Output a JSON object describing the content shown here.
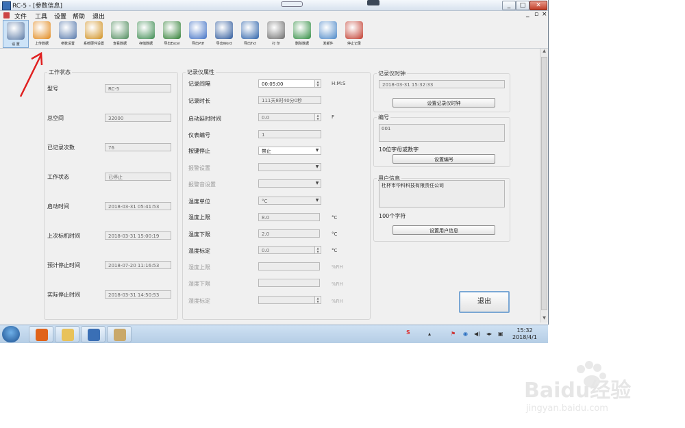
{
  "window": {
    "title": "RC-5 - [参数信息]"
  },
  "menu": [
    "文件",
    "工具",
    "设置",
    "帮助",
    "退出"
  ],
  "toolbar": [
    {
      "label": "设 置",
      "icon": "settings-icon",
      "color": "#5a7aa6"
    },
    {
      "label": "上传数据",
      "icon": "upload-icon",
      "color": "#e0871a"
    },
    {
      "label": "参数设置",
      "icon": "gear-icon",
      "color": "#5577aa"
    },
    {
      "label": "系统硬件设置",
      "icon": "hardware-gear-icon",
      "color": "#d09020"
    },
    {
      "label": "查看数据",
      "icon": "view-data-icon",
      "color": "#4d8a5a"
    },
    {
      "label": "存储数据",
      "icon": "save-data-icon",
      "color": "#3b8a4f"
    },
    {
      "label": "导出Excel",
      "icon": "excel-icon",
      "color": "#2e7d32"
    },
    {
      "label": "导出Pdf",
      "icon": "pdf-icon",
      "color": "#3f6fc4"
    },
    {
      "label": "导出Word",
      "icon": "word-icon",
      "color": "#2b579a"
    },
    {
      "label": "导出Txt",
      "icon": "txt-icon",
      "color": "#2a60a8"
    },
    {
      "label": "打 印",
      "icon": "printer-icon",
      "color": "#6b6b6b"
    },
    {
      "label": "删除数据",
      "icon": "trash-icon",
      "color": "#2e8b3f"
    },
    {
      "label": "发邮件",
      "icon": "mail-icon",
      "color": "#4a86c7"
    },
    {
      "label": "停止记录",
      "icon": "stop-record-icon",
      "color": "#c0392b"
    }
  ],
  "work_status": {
    "title": "工作状态",
    "rows": [
      {
        "label": "型号",
        "value": "RC-5"
      },
      {
        "label": "总空间",
        "value": "32000"
      },
      {
        "label": "已记录次数",
        "value": "76"
      },
      {
        "label": "工作状态",
        "value": "已停止"
      },
      {
        "label": "启动时间",
        "value": "2018-03-31 05:41:53"
      },
      {
        "label": "上次标机时间",
        "value": "2018-03-31 15:00:19"
      },
      {
        "label": "预计停止时间",
        "value": "2018-07-20 11:16:53"
      },
      {
        "label": "实际停止时间",
        "value": "2018-03-31 14:50:53"
      }
    ]
  },
  "recorder_props": {
    "title": "记录仪属性",
    "interval": {
      "label": "记录间隔",
      "value": "00:05:00",
      "unit": "H:M:S"
    },
    "duration": {
      "label": "记录时长",
      "value": "111天8时40分0秒"
    },
    "delay": {
      "label": "启动延时时间",
      "value": "0.0",
      "unit": "F"
    },
    "instrument_no": {
      "label": "仪表编号",
      "value": "1"
    },
    "key_stop": {
      "label": "按键停止",
      "value": "禁止"
    },
    "alarm": {
      "label": "报警设置",
      "value": ""
    },
    "alarm_tone": {
      "label": "报警音设置",
      "value": ""
    },
    "temp_unit": {
      "label": "温度单位",
      "value": "°C"
    },
    "temp_upper": {
      "label": "温度上限",
      "value": "8.0",
      "unit": "°C"
    },
    "temp_lower": {
      "label": "温度下限",
      "value": "2.0",
      "unit": "°C"
    },
    "temp_calib": {
      "label": "温度标定",
      "value": "0.0",
      "unit": "°C"
    },
    "hum_upper": {
      "label": "湿度上限",
      "value": "",
      "unit": "%RH"
    },
    "hum_lower": {
      "label": "湿度下限",
      "value": "",
      "unit": "%RH"
    },
    "hum_calib": {
      "label": "湿度标定",
      "value": "",
      "unit": "%RH"
    }
  },
  "clock": {
    "title": "记录仪时钟",
    "value": "2018-03-31 15:32:33",
    "button": "设置记录仪时钟"
  },
  "serial": {
    "title": "编号",
    "value": "001",
    "hint": "10位字母或数字",
    "button": "设置编号"
  },
  "user_info": {
    "title": "用户信息",
    "value": "杜杯市华科科技有限责任公司",
    "hint": "100个字符",
    "button": "设置用户信息"
  },
  "exit_button": "退出",
  "taskbar": {
    "apps": [
      {
        "name": "browser",
        "color": "#e0631a"
      },
      {
        "name": "explorer",
        "color": "#e8c25a"
      },
      {
        "name": "rc5-app",
        "color": "#3a6fb5"
      },
      {
        "name": "paint",
        "color": "#c9a86a"
      }
    ],
    "time": "15:32",
    "date": "2018/4/1"
  },
  "watermark": {
    "brand": "Baidu经验",
    "url": "jingyan.baidu.com"
  }
}
